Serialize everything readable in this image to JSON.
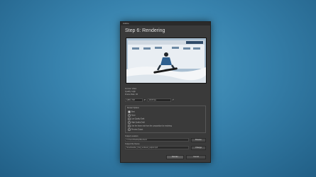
{
  "window": {
    "title": "Adobe",
    "heading": "Step 6: Rendering"
  },
  "preview": {
    "scene": "snowboarder-jumping-in-front-of-banner",
    "banner_text": "Step 6:"
  },
  "info": {
    "line1": "Format: Video",
    "line2": "Quality: High",
    "line3": "Frame Rate: 30"
  },
  "controls": {
    "size_select": "1280 x 720",
    "rate_select": "29.97 fps",
    "spin_up": "▲",
    "spin_down": "▼"
  },
  "options": {
    "header": "Render Options",
    "items": [
      {
        "label": "Best",
        "selected": true
      },
      {
        "label": "None",
        "selected": false
      },
      {
        "label": "Low Quality Draft",
        "selected": false
      },
      {
        "label": "High Quality Draft",
        "selected": false
      },
      {
        "label": "Use the frame rate from the composition for rendering",
        "selected": false
      },
      {
        "label": "Preview Output",
        "selected": false
      }
    ]
  },
  "output": {
    "label": "Output Location:",
    "path": "C:\\Users\\Desktop\\Renders\\",
    "browse_label": "Browse",
    "file_label": "Output File Name:",
    "file_value": "Snowboarder_final_rendered_output.mp4",
    "change_label": "Change"
  },
  "footer": {
    "render_label": "Render",
    "cancel_label": "Cancel"
  }
}
